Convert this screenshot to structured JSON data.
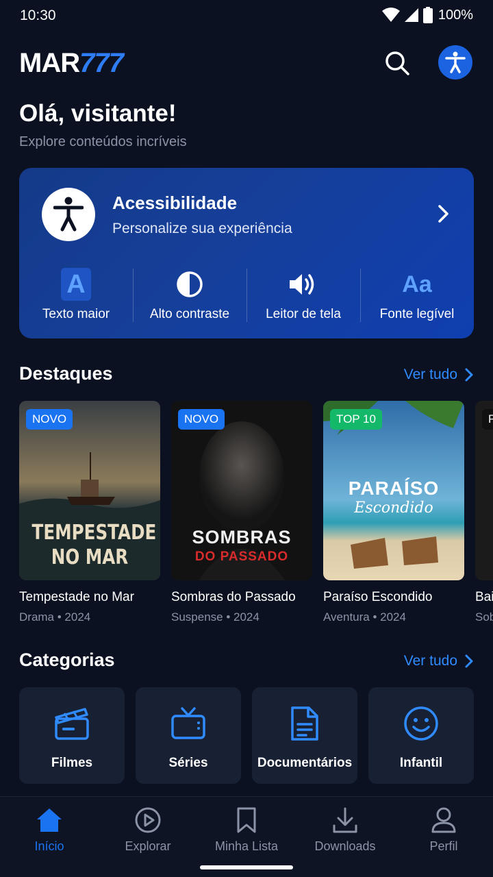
{
  "status": {
    "time": "10:30",
    "battery": "100%"
  },
  "header": {
    "logo_main": "MAR",
    "logo_accent": "777",
    "accent_color": "#2f7df6"
  },
  "greeting": {
    "title": "Olá, visitante!",
    "subtitle": "Explore conteúdos incríveis"
  },
  "accessibility": {
    "title": "Acessibilidade",
    "subtitle": "Personalize sua experiência",
    "options": [
      {
        "icon": "text-size-icon",
        "glyph": "A",
        "label": "Texto maior"
      },
      {
        "icon": "contrast-icon",
        "label": "Alto contraste"
      },
      {
        "icon": "speaker-icon",
        "label": "Leitor de tela"
      },
      {
        "icon": "font-icon",
        "glyph": "Aa",
        "label": "Fonte legível"
      }
    ]
  },
  "featured": {
    "title": "Destaques",
    "see_all": "Ver tudo",
    "items": [
      {
        "badge": "NOVO",
        "poster_line1": "TEMPESTADE",
        "poster_line2": "NO MAR",
        "title": "Tempestade no Mar",
        "meta": "Drama • 2024"
      },
      {
        "badge": "NOVO",
        "poster_line1": "SOMBRAS",
        "poster_line2": "DO PASSADO",
        "title": "Sombras do Passado",
        "meta": "Suspense • 2024"
      },
      {
        "badge": "TOP 10",
        "poster_line1": "PARAÍSO",
        "poster_line2": "Escondido",
        "title": "Paraíso Escondido",
        "meta": "Aventura • 2024"
      },
      {
        "badge": "F",
        "title": "Bai",
        "meta": "Sob"
      }
    ]
  },
  "categories": {
    "title": "Categorias",
    "see_all": "Ver tudo",
    "items": [
      {
        "icon": "clapperboard-icon",
        "label": "Filmes"
      },
      {
        "icon": "tv-icon",
        "label": "Séries"
      },
      {
        "icon": "document-icon",
        "label": "Documentários"
      },
      {
        "icon": "smiley-icon",
        "label": "Infantil"
      }
    ]
  },
  "nav": {
    "items": [
      {
        "icon": "home-icon",
        "label": "Início",
        "active": true
      },
      {
        "icon": "play-circle-icon",
        "label": "Explorar"
      },
      {
        "icon": "bookmark-icon",
        "label": "Minha Lista"
      },
      {
        "icon": "download-icon",
        "label": "Downloads"
      },
      {
        "icon": "user-icon",
        "label": "Perfil"
      }
    ]
  }
}
